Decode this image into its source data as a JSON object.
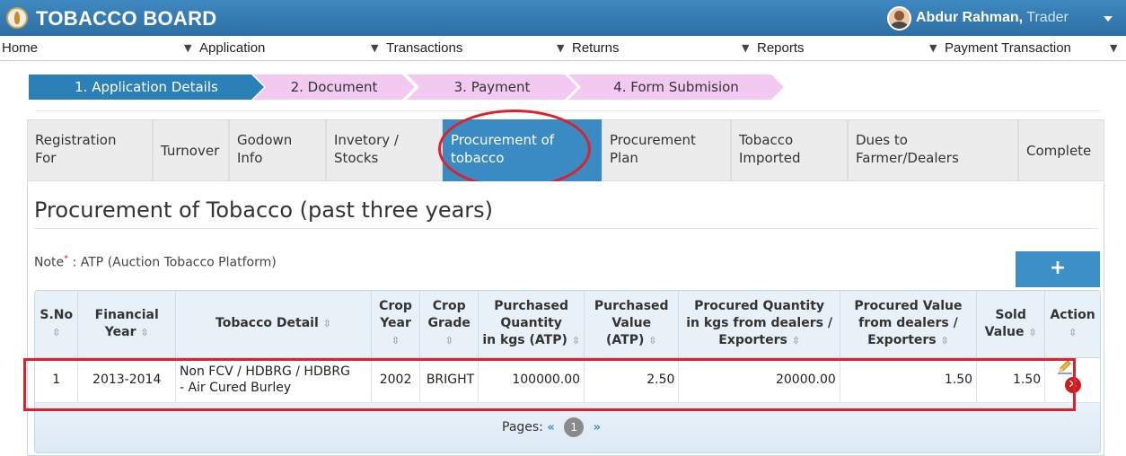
{
  "header": {
    "brand": "TOBACCO BOARD",
    "user_name": "Abdur Rahman,",
    "user_role": " Trader"
  },
  "menu": [
    {
      "label": "Home"
    },
    {
      "label": "Application"
    },
    {
      "label": "Transactions"
    },
    {
      "label": "Returns"
    },
    {
      "label": "Reports"
    },
    {
      "label": "Payment Transaction"
    }
  ],
  "wizard": [
    {
      "label": "1. Application Details",
      "state": "active"
    },
    {
      "label": "2. Document",
      "state": "pending"
    },
    {
      "label": "3. Payment",
      "state": "pending"
    },
    {
      "label": "4. Form Submision",
      "state": "pending"
    }
  ],
  "tabs": [
    {
      "line1": "Registration",
      "line2": "For"
    },
    {
      "line1": "Turnover",
      "line2": ""
    },
    {
      "line1": "Godown",
      "line2": "Info"
    },
    {
      "line1": "Invetory /",
      "line2": "Stocks"
    },
    {
      "line1": "Procurement of",
      "line2": "tobacco",
      "active": true
    },
    {
      "line1": "Procurement",
      "line2": "Plan"
    },
    {
      "line1": "Tobacco",
      "line2": "Imported"
    },
    {
      "line1": "Dues to",
      "line2": "Farmer/Dealers"
    },
    {
      "line1": "Complete",
      "line2": ""
    }
  ],
  "page": {
    "title": "Procurement of Tobacco (past three years)",
    "note_label": "Note",
    "note_star": "*",
    "note_text": " : ATP (Auction Tobacco Platform)",
    "add_label": "+"
  },
  "table": {
    "headers": [
      {
        "l1": "S.No",
        "l2": ""
      },
      {
        "l1": "Financial",
        "l2": "Year"
      },
      {
        "l1": "Tobacco Detail",
        "l2": ""
      },
      {
        "l1": "Crop",
        "l2": "Year"
      },
      {
        "l1": "Crop",
        "l2": "Grade"
      },
      {
        "l1": "Purchased",
        "l2": "Quantity",
        "l3": "in kgs (ATP)"
      },
      {
        "l1": "Purchased",
        "l2": "Value",
        "l3": "(ATP)"
      },
      {
        "l1": "Procured Quantity",
        "l2": "in kgs from dealers /",
        "l3": "Exporters"
      },
      {
        "l1": "Procured Value",
        "l2": "from dealers /",
        "l3": "Exporters"
      },
      {
        "l1": "Sold",
        "l2": "Value"
      },
      {
        "l1": "Action",
        "l2": ""
      }
    ],
    "sort_glyph": "⇳",
    "rows": [
      {
        "sno": "1",
        "fin_year": "2013-2014",
        "detail_l1": "Non FCV / HDBRG / HDBRG",
        "detail_l2": "- Air Cured Burley",
        "crop_year": "2002",
        "crop_grade": "BRIGHT",
        "pq_atp": "100000.00",
        "pv_atp": "2.50",
        "pq_dealers": "20000.00",
        "pv_dealers": "1.50",
        "sold": "1.50"
      }
    ]
  },
  "pager": {
    "label": "Pages:",
    "prev": "«",
    "current": "1",
    "next": "»"
  },
  "icons": {
    "delete_glyph": "✕"
  },
  "colors": {
    "brand_blue": "#2d6fa4",
    "active_tab": "#3a8ac4",
    "highlight_red": "#e0202a",
    "wizard_pending": "#f2c9f0"
  }
}
